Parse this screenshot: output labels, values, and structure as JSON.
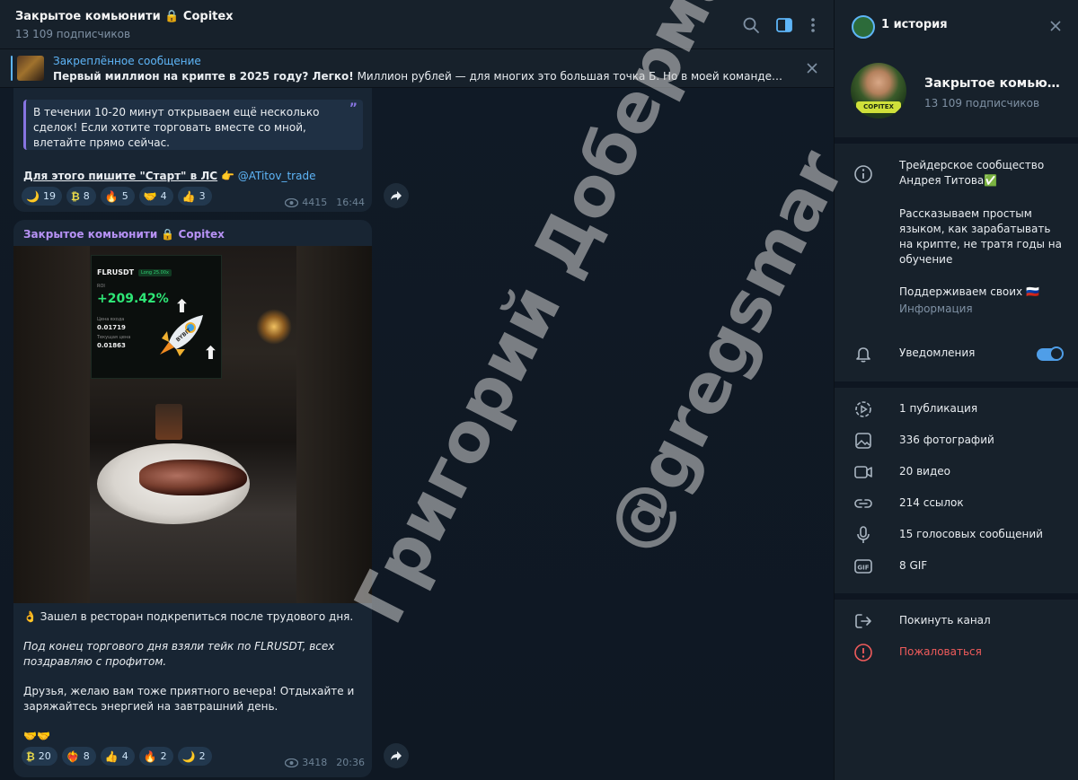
{
  "chat": {
    "title": "Закрытое комьюнити 🔒 Copitex",
    "subscribers": "13 109 подписчиков",
    "pinned": {
      "label": "Закреплённое сообщение",
      "bold": "Первый миллион на крипте в 2025 году? Легко!",
      "text": " Миллион рублей — для многих это большая точка Б. Но в моей команде люди даже с м..."
    }
  },
  "messages": [
    {
      "quote": "В течении 10-20 минут открываем ещё несколько сделок! Если хотите торговать вместе со мной, влетайте прямо сейчас.",
      "cta_bold": "Для этого пишите \"Старт\" в ЛС",
      "cta_emoji": "👉",
      "cta_link": "@ATitov_trade",
      "reactions": [
        {
          "emoji": "🌙",
          "count": "19"
        },
        {
          "emoji": "₿",
          "count": "8"
        },
        {
          "emoji": "🔥",
          "count": "5"
        },
        {
          "emoji": "🤝",
          "count": "4"
        },
        {
          "emoji": "👍",
          "count": "3"
        }
      ],
      "views": "4415",
      "time": "16:44"
    },
    {
      "author": "Закрытое комьюнити 🔒 Copitex",
      "photo": {
        "pair": "FLRUSDT",
        "tag": "Long 25.00x",
        "roi_label": "ROI",
        "roi": "+209.42%",
        "entry_label": "Цена входа",
        "entry": "0.01719",
        "current_label": "Текущая цена",
        "current": "0.01863",
        "rocket_text": "BYBIT"
      },
      "line1": "👌 Зашел в ресторан подкрепиться после трудового дня.",
      "line2": "Под конец торгового дня взяли тейк по FLRUSDT, всех поздравляю с профитом.",
      "line3": "Друзья, желаю вам тоже приятного вечера! Отдыхайте и заряжайтесь энергией на завтрашний день.",
      "line4": "🤝🤝",
      "reactions": [
        {
          "emoji": "₿",
          "count": "20"
        },
        {
          "emoji": "❤️‍🔥",
          "count": "8"
        },
        {
          "emoji": "👍",
          "count": "4"
        },
        {
          "emoji": "🔥",
          "count": "2"
        },
        {
          "emoji": "🌙",
          "count": "2"
        }
      ],
      "views": "3418",
      "time": "20:36"
    }
  ],
  "watermark": {
    "line1": "Григорий Доберман",
    "line2": "@gregsmar"
  },
  "panel": {
    "header": "1 история",
    "channel_name": "Закрытое комьюнити 🔒 Copitex",
    "channel_subs": "13 109 подписчиков",
    "avatar_badge": "COPITEX",
    "description1": "Трейдерское сообщество Андрея Титова✅",
    "description2": "Рассказываем простым языком, как зарабатывать на крипте, не тратя годы на обучение",
    "description3": "Поддерживаем своих 🇷🇺",
    "info_label": "Информация",
    "notifications": "Уведомления",
    "stats": [
      {
        "icon": "stories-icon",
        "label": "1 публикация"
      },
      {
        "icon": "photo-icon",
        "label": "336 фотографий"
      },
      {
        "icon": "video-icon",
        "label": "20 видео"
      },
      {
        "icon": "link-icon",
        "label": "214 ссылок"
      },
      {
        "icon": "microphone-icon",
        "label": "15 голосовых сообщений"
      },
      {
        "icon": "gif-icon",
        "label": "8 GIF"
      }
    ],
    "leave": "Покинуть канал",
    "report": "Пожаловаться"
  },
  "colors": {
    "accent": "#5eb5f7",
    "author": "#b792f5",
    "danger": "#ef5b5b",
    "roi_green": "#2ee676"
  }
}
